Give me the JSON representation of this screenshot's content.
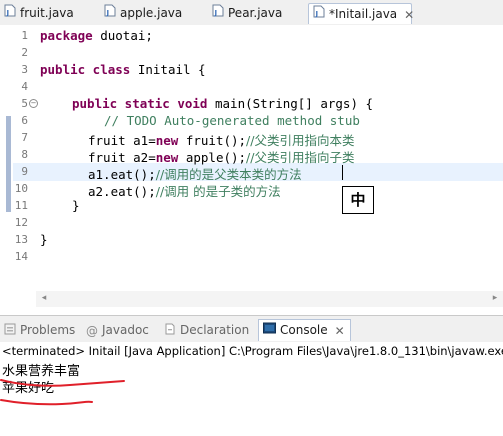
{
  "editor_tabs": [
    {
      "label": "fruit.java",
      "active": false
    },
    {
      "label": "apple.java",
      "active": false
    },
    {
      "label": "Pear.java",
      "active": false
    },
    {
      "label": "*Initail.java",
      "active": true
    }
  ],
  "code": {
    "line_numbers": [
      "1",
      "2",
      "3",
      "4",
      "5",
      "6",
      "7",
      "8",
      "9",
      "10",
      "11",
      "12",
      "13",
      "14"
    ],
    "package_kw": "package",
    "package_name": " duotai;",
    "class_kw": "public class",
    "class_rest": " Initail {",
    "main_kw": "public static void",
    "main_rest": " main(String[] args) {",
    "todo_comment": "// TODO Auto-generated method stub",
    "line7_code": "fruit a1=",
    "line7_new": "new",
    "line7_rest": " fruit();",
    "line7_comment": "//父类引用指向本类",
    "line8_code": "fruit a2=",
    "line8_new": "new",
    "line8_rest": " apple();",
    "line8_comment": "//父类引用指向子类",
    "line9_code": "a1.eat();",
    "line9_comment": "//调用的是父类本类的方法",
    "line10_code": "a2.eat();",
    "line10_comment": "//调用 的是子类的方法",
    "close_brace_inner": "}",
    "close_brace_outer": "}"
  },
  "ime_char": "中",
  "view_tabs": [
    {
      "label": "Problems",
      "icon": "problems-icon",
      "active": false
    },
    {
      "label": "Javadoc",
      "icon": "at-icon",
      "active": false
    },
    {
      "label": "Declaration",
      "icon": "declaration-icon",
      "active": false
    },
    {
      "label": "Console",
      "icon": "console-icon",
      "active": true
    }
  ],
  "console": {
    "header": "<terminated> Initail [Java Application] C:\\Program Files\\Java\\jre1.8.0_131\\bin\\javaw.exe",
    "output": [
      "水果营养丰富",
      "苹果好吃"
    ]
  },
  "colors": {
    "keyword": "#7f0055",
    "comment": "#3f7f5f",
    "current_line": "#e8f2fe",
    "annotation_red": "#e0202a"
  }
}
